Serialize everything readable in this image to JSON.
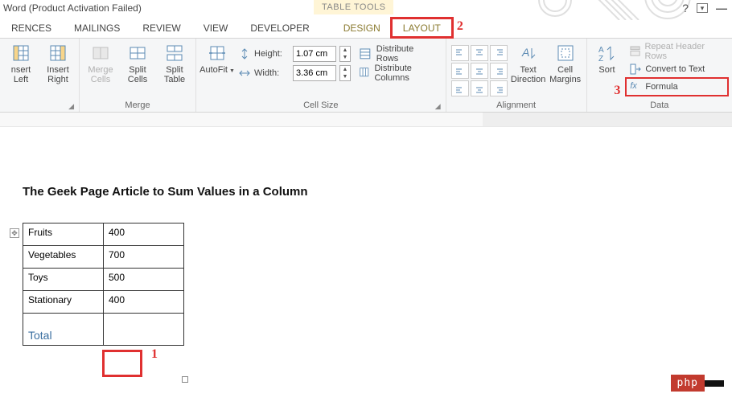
{
  "title": "Word (Product Activation Failed)",
  "context_tool_label": "TABLE TOOLS",
  "help_icon": "?",
  "tabs": {
    "references": "RENCES",
    "mailings": "MAILINGS",
    "review": "REVIEW",
    "view": "VIEW",
    "developer": "DEVELOPER",
    "design": "DESIGN",
    "layout": "LAYOUT"
  },
  "annotations": {
    "n1": "1",
    "n2": "2",
    "n3": "3"
  },
  "ribbon": {
    "rows_cols": {
      "insert_left": "nsert\nLeft",
      "insert_right": "Insert\nRight"
    },
    "merge": {
      "label": "Merge",
      "merge_cells": "Merge\nCells",
      "split_cells": "Split\nCells",
      "split_table": "Split\nTable"
    },
    "cell_size": {
      "label": "Cell Size",
      "autofit": "AutoFit",
      "height_label": "Height:",
      "height_value": "1.07 cm",
      "width_label": "Width:",
      "width_value": "3.36 cm",
      "dist_rows": "Distribute Rows",
      "dist_cols": "Distribute Columns"
    },
    "alignment": {
      "label": "Alignment",
      "text_direction": "Text\nDirection",
      "cell_margins": "Cell\nMargins"
    },
    "data": {
      "label": "Data",
      "sort": "Sort",
      "repeat_header": "Repeat Header Rows",
      "convert_text": "Convert to Text",
      "formula": "Formula"
    }
  },
  "document": {
    "heading": "The Geek Page Article to Sum Values in a Column",
    "rows": [
      {
        "label": "Fruits",
        "value": "400"
      },
      {
        "label": "Vegetables",
        "value": "700"
      },
      {
        "label": "Toys",
        "value": "500"
      },
      {
        "label": "Stationary",
        "value": "400"
      }
    ],
    "total_label": "Total",
    "total_value": ""
  },
  "watermark": {
    "a": "php",
    "b": ""
  }
}
